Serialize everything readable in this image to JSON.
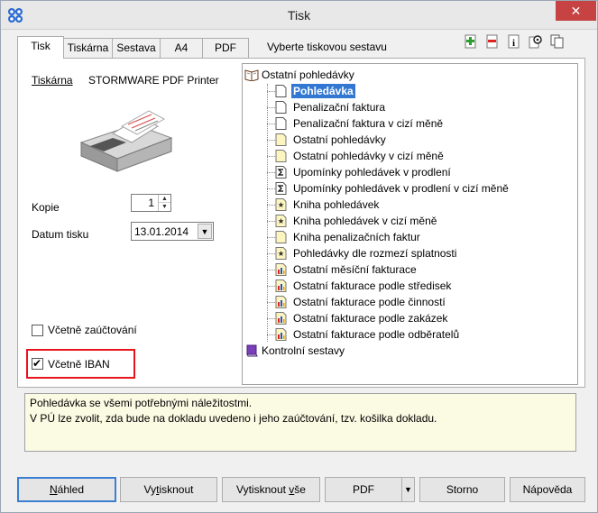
{
  "window": {
    "title": "Tisk",
    "close_glyph": "✕"
  },
  "tabs": [
    {
      "label": "Tisk",
      "active": true
    },
    {
      "label": "Tiskárna",
      "active": false
    },
    {
      "label": "Sestava",
      "active": false
    },
    {
      "label": "A4",
      "active": false
    },
    {
      "label": "PDF",
      "active": false
    }
  ],
  "tab_hint": "Vyberte tiskovou sestavu",
  "toolbar": {
    "icons": [
      "add-icon",
      "remove-icon",
      "info-icon",
      "settings-icon",
      "copy-icon"
    ],
    "info_glyph": "i"
  },
  "print_panel": {
    "printer_label": "Tiskárna",
    "printer_name": "STORMWARE PDF Printer",
    "copies_label": "Kopie",
    "copies_value": "1",
    "date_label": "Datum tisku",
    "date_value": "13.01.2014",
    "include_accounting_label": "Včetně zaúčtování",
    "include_accounting_checked": false,
    "include_iban_label": "Včetně IBAN",
    "include_iban_checked": true,
    "check_glyph": "✔",
    "spin_up_glyph": "▲",
    "spin_down_glyph": "▼",
    "dropdown_glyph": "▼"
  },
  "report_tree": {
    "groups": [
      {
        "label": "Ostatní pohledávky",
        "icon": "open-book-icon",
        "items": [
          {
            "label": "Pohledávka",
            "icon": "document-icon",
            "selected": true
          },
          {
            "label": "Penalizační faktura",
            "icon": "document-icon",
            "selected": false
          },
          {
            "label": "Penalizační faktura v cizí měně",
            "icon": "document-icon",
            "selected": false
          },
          {
            "label": "Ostatní pohledávky",
            "icon": "list-document-icon",
            "selected": false
          },
          {
            "label": "Ostatní pohledávky v cizí měně",
            "icon": "list-document-icon",
            "selected": false
          },
          {
            "label": "Upomínky pohledávek v prodlení",
            "icon": "sum-icon",
            "selected": false
          },
          {
            "label": "Upomínky pohledávek v prodlení v cizí měně",
            "icon": "sum-icon",
            "selected": false
          },
          {
            "label": "Kniha pohledávek",
            "icon": "star-document-icon",
            "selected": false
          },
          {
            "label": "Kniha pohledávek v cizí měně",
            "icon": "star-document-icon",
            "selected": false
          },
          {
            "label": "Kniha penalizačních faktur",
            "icon": "list-document-icon",
            "selected": false
          },
          {
            "label": "Pohledávky dle rozmezí splatnosti",
            "icon": "star-document-icon",
            "selected": false
          },
          {
            "label": "Ostatní měsíční fakturace",
            "icon": "bar-chart-icon",
            "selected": false
          },
          {
            "label": "Ostatní fakturace podle středisek",
            "icon": "bar-chart-icon",
            "selected": false
          },
          {
            "label": "Ostatní fakturace podle činností",
            "icon": "bar-chart-icon",
            "selected": false
          },
          {
            "label": "Ostatní fakturace podle zakázek",
            "icon": "bar-chart-icon",
            "selected": false
          },
          {
            "label": "Ostatní fakturace podle odběratelů",
            "icon": "bar-chart-icon",
            "selected": false
          }
        ]
      },
      {
        "label": "Kontrolní sestavy",
        "icon": "closed-book-icon",
        "items": []
      }
    ]
  },
  "description": {
    "line1": "Pohledávka se všemi potřebnými náležitostmi.",
    "line2": "V PÚ lze zvolit, zda bude na dokladu uvedeno i jeho zaúčtování, tzv. košilka dokladu."
  },
  "buttons": {
    "preview": {
      "pre": "",
      "acc": "N",
      "post": "áhled"
    },
    "print": {
      "pre": "Vy",
      "acc": "t",
      "post": "isknout"
    },
    "print_all": {
      "pre": "Vytisknout ",
      "acc": "v",
      "post": "še"
    },
    "pdf": {
      "label": "PDF",
      "split_glyph": "▼"
    },
    "cancel": {
      "label": "Storno"
    },
    "help": {
      "label": "Nápověda"
    }
  },
  "colors": {
    "selection": "#3278d2",
    "highlight_frame": "#e8141c",
    "description_bg": "#fbfbe4",
    "close_button": "#c74343"
  }
}
